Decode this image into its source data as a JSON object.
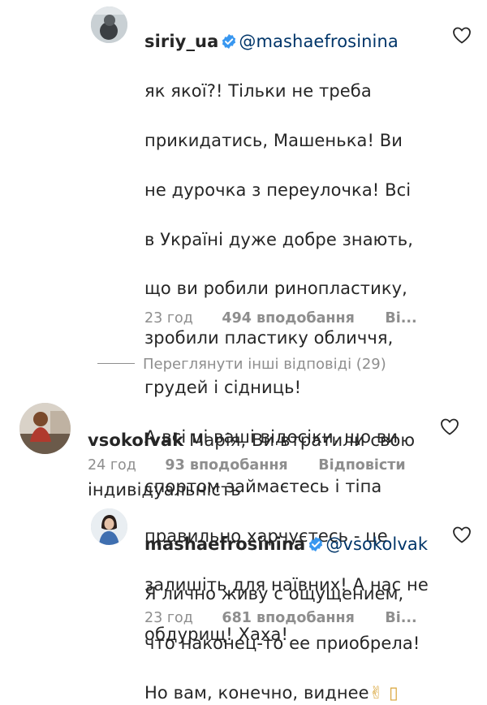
{
  "comments": [
    {
      "username": "siriy_ua",
      "mention": "@mashaefrosinina",
      "text": "як якої?! Тільки не треба прикидатись, Машенька! Ви не дурочка з переулочка! Всі в Україні дуже добре знають, що ви робили ринопластику, зробили пластику обличчя, грудей і сідниць!\nА всі ці ваші відосіки, що ви спортом займаєтесь і тіпа правильно харчуєтесь - це залишіть для наївних! А нас не обдурищ! Хаха!",
      "line1_rest": "як якої?! Тільки не треба",
      "lines": [
        "прикидатись, Машенька! Ви",
        "не дурочка з переулочка! Всі",
        "в Україні дуже добре знають,",
        "що ви робили ринопластику,",
        "зробили пластику обличчя,",
        "грудей і сідниць!",
        "А всі ці ваші відосіки, що ви",
        "спортом займаєтесь і тіпа",
        "правильно харчуєтесь - це",
        "залишіть для наївних! А нас не",
        "обдурищ! Хаха!"
      ],
      "time": "23 год",
      "likes": "494 вподобання",
      "reply": "Ві...",
      "verified": true
    },
    {
      "username": "vsokolvak",
      "text_line1": "Марія, Ви втратили свою",
      "text_line2": "індивідуальність",
      "time": "24 год",
      "likes": "93 вподобання",
      "reply": "Відповісти"
    },
    {
      "username": "mashaefrosinina",
      "mention": "@vsokolvak",
      "line2": "Я лично живу с ощущением,",
      "line3": "что наконец-то ее приобрела!",
      "line4": "Но вам, конечно, виднее",
      "emoji": "✌ ▯",
      "time": "23 год",
      "likes": "681 вподобання",
      "reply": "Ві...",
      "verified": true
    }
  ],
  "view_replies": "Переглянути інші відповіді (29)",
  "colors": {
    "text": "#262626",
    "secondary": "#8e8e8e",
    "mention": "#003569",
    "verified": "#3897f0"
  },
  "icons": {
    "like": "heart-outline-icon",
    "verified": "verified-badge-icon"
  }
}
